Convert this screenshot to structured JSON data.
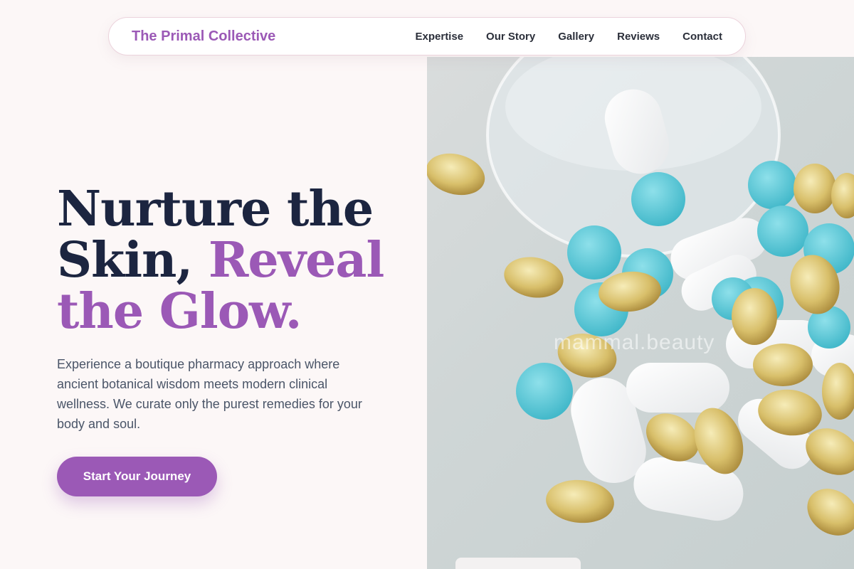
{
  "nav": {
    "brand": "The Primal Collective",
    "links": [
      {
        "label": "Expertise"
      },
      {
        "label": "Our Story"
      },
      {
        "label": "Gallery"
      },
      {
        "label": "Reviews"
      },
      {
        "label": "Contact"
      }
    ]
  },
  "hero": {
    "headline_part1": "Nurture the Skin, ",
    "headline_accent": "Reveal the Glow.",
    "description": "Experience a boutique pharmacy approach where ancient botanical wisdom meets modern clinical wellness. We curate only the purest remedies for your body and soul.",
    "cta_label": "Start Your Journey",
    "image_watermark": "mammal.beauty"
  },
  "colors": {
    "accent": "#9b59b6",
    "heading": "#1c2540",
    "background": "#fcf7f7"
  }
}
